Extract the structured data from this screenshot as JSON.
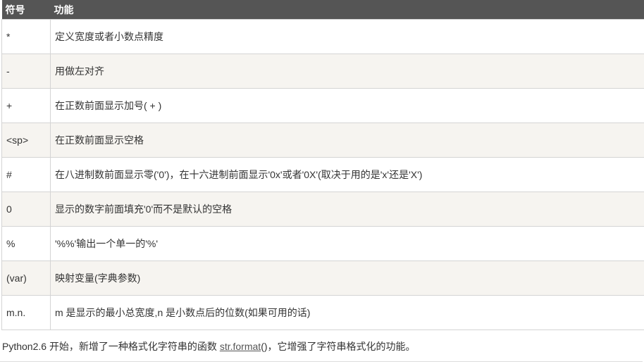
{
  "table": {
    "headers": [
      "符号",
      "功能"
    ],
    "rows": [
      {
        "symbol": "*",
        "desc": "定义宽度或者小数点精度"
      },
      {
        "symbol": "-",
        "desc": "用做左对齐"
      },
      {
        "symbol": "+",
        "desc": "在正数前面显示加号( + )"
      },
      {
        "symbol": "<sp>",
        "desc": "在正数前面显示空格"
      },
      {
        "symbol": "#",
        "desc": "在八进制数前面显示零('0')，在十六进制前面显示'0x'或者'0X'(取决于用的是'x'还是'X')"
      },
      {
        "symbol": "0",
        "desc": "显示的数字前面填充'0'而不是默认的空格"
      },
      {
        "symbol": "%",
        "desc": "'%%'输出一个单一的'%'"
      },
      {
        "symbol": "(var)",
        "desc": "映射变量(字典参数)"
      },
      {
        "symbol": "m.n.",
        "desc": "m 是显示的最小总宽度,n 是小数点后的位数(如果可用的话)"
      }
    ]
  },
  "paragraph": {
    "before": "Python2.6 开始，新增了一种格式化字符串的函数 ",
    "link": "str.format",
    "after_link": "()，它增强了字符串格式化的功能。"
  }
}
